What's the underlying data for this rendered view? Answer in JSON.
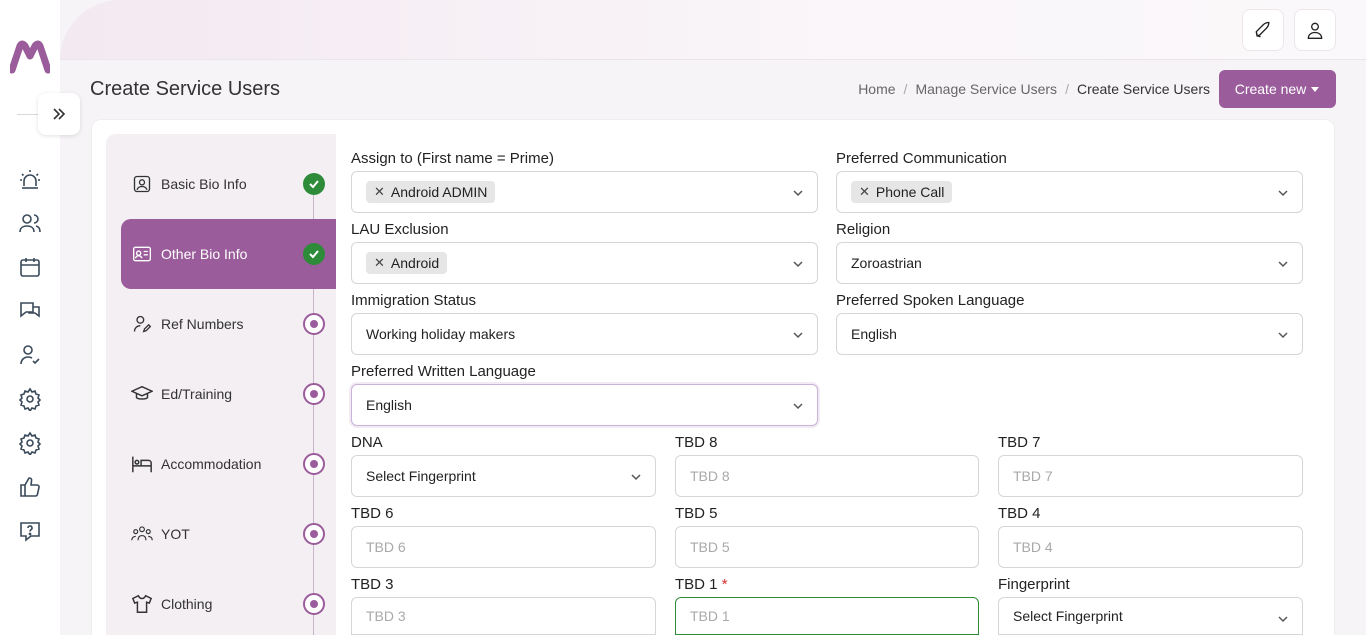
{
  "header": {
    "title": "Create Service Users",
    "breadcrumb": [
      "Home",
      "Manage Service Users",
      "Create Service Users"
    ],
    "create_button": "Create new",
    "brand_color": "#9a5c9a"
  },
  "rail": {
    "icons": [
      "alarm-icon",
      "users-icon",
      "calendar-icon",
      "chat-icon",
      "user-check-icon",
      "settings-icon",
      "settings-icon",
      "thumbs-up-icon",
      "help-icon"
    ]
  },
  "steps": [
    {
      "label": "Basic Bio Info",
      "icon": "contact-icon",
      "status": "done"
    },
    {
      "label": "Other Bio Info",
      "icon": "id-card-icon",
      "status": "done",
      "active": true
    },
    {
      "label": "Ref Numbers",
      "icon": "user-edit-icon",
      "status": "pending"
    },
    {
      "label": "Ed/Training",
      "icon": "graduation-cap-icon",
      "status": "pending"
    },
    {
      "label": "Accommodation",
      "icon": "bed-icon",
      "status": "pending"
    },
    {
      "label": "YOT",
      "icon": "group-icon",
      "status": "pending"
    },
    {
      "label": "Clothing",
      "icon": "shirt-icon",
      "status": "pending"
    }
  ],
  "form": {
    "assign_to": {
      "label": "Assign to (First name = Prime)",
      "chips": [
        "Android ADMIN"
      ]
    },
    "preferred_communication": {
      "label": "Preferred Communication",
      "chips": [
        "Phone Call"
      ]
    },
    "lau_exclusion": {
      "label": "LAU Exclusion",
      "chips": [
        "Android"
      ]
    },
    "religion": {
      "label": "Religion",
      "value": "Zoroastrian"
    },
    "immigration_status": {
      "label": "Immigration Status",
      "value": "Working holiday makers"
    },
    "preferred_spoken_language": {
      "label": "Preferred Spoken Language",
      "value": "English"
    },
    "preferred_written_language": {
      "label": "Preferred Written Language",
      "value": "English"
    },
    "dna": {
      "label": "DNA",
      "value": "Select Fingerprint"
    },
    "tbd8": {
      "label": "TBD 8",
      "placeholder": "TBD 8"
    },
    "tbd7": {
      "label": "TBD 7",
      "placeholder": "TBD 7"
    },
    "tbd6": {
      "label": "TBD 6",
      "placeholder": "TBD 6"
    },
    "tbd5": {
      "label": "TBD 5",
      "placeholder": "TBD 5"
    },
    "tbd4": {
      "label": "TBD 4",
      "placeholder": "TBD 4"
    },
    "tbd3": {
      "label": "TBD 3",
      "placeholder": "TBD 3"
    },
    "tbd1": {
      "label": "TBD 1",
      "required_mark": "*",
      "placeholder": "TBD 1"
    },
    "fingerprint": {
      "label": "Fingerprint",
      "value": "Select Fingerprint"
    }
  }
}
